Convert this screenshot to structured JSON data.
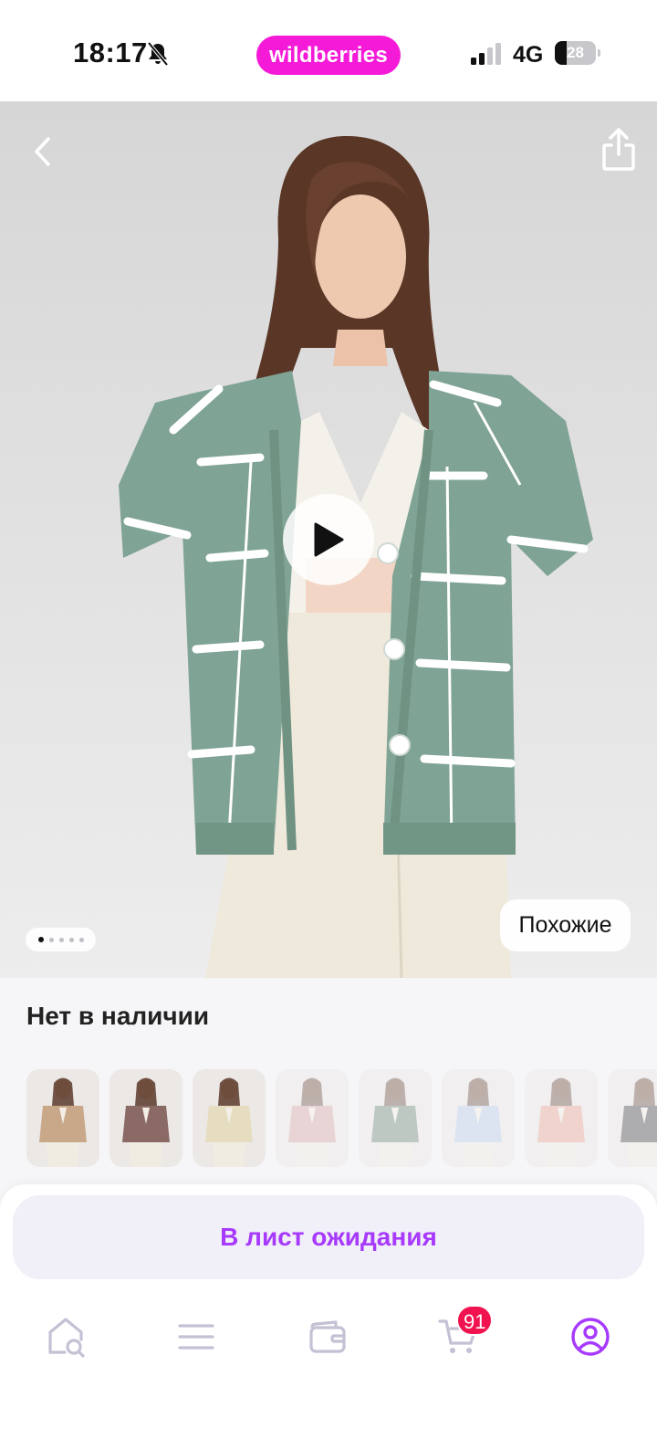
{
  "status_bar": {
    "time": "18:17",
    "network": "4G",
    "battery_level": "28",
    "battery_fraction": 0.28,
    "icons": [
      "bell-muted-icon",
      "signal-icon",
      "battery-icon"
    ]
  },
  "brand": {
    "logo_text": "wildberries",
    "color": "#f51ad8"
  },
  "gallery": {
    "similar_label": "Похожие",
    "page_count": 5,
    "active_index": 0
  },
  "product": {
    "availability": "Нет в наличии"
  },
  "thumbnails": [
    {
      "name": "beige-cardigan",
      "color": "#c9a88a",
      "faded": false
    },
    {
      "name": "brown-cardigan",
      "color": "#8b6a66",
      "faded": false
    },
    {
      "name": "cream-cardigan",
      "color": "#e6dcc0",
      "faded": false
    },
    {
      "name": "pink-check-cardigan",
      "color": "#d9a9a6",
      "faded": true
    },
    {
      "name": "green-check-cardigan",
      "color": "#6f8c78",
      "faded": true
    },
    {
      "name": "light-blue-cardigan",
      "color": "#b9cfe9",
      "faded": true
    },
    {
      "name": "peach-check-cardigan",
      "color": "#e6a591",
      "faded": true
    },
    {
      "name": "dark-cardigan",
      "color": "#4a4a4a",
      "faded": true
    }
  ],
  "actions": {
    "waitlist_label": "В лист ожидания",
    "accent": "#a73afd"
  },
  "tabbar": {
    "cart_badge": "91",
    "badge_color": "#f1134f",
    "items": [
      "home-search-icon",
      "menu-icon",
      "wallet-icon",
      "cart-icon",
      "profile-icon"
    ]
  }
}
